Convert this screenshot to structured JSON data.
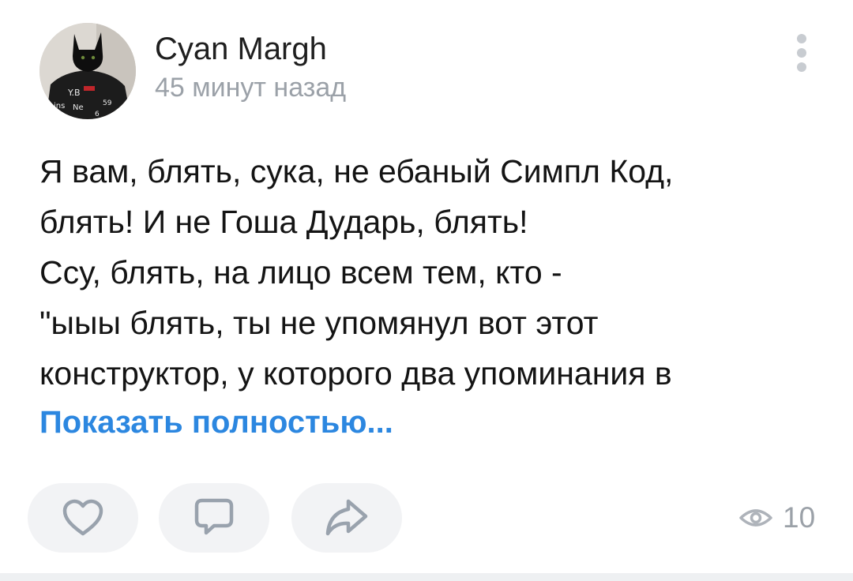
{
  "author": {
    "name": "Cyan Margh",
    "avatar_icon": "black-cat-avatar"
  },
  "post": {
    "time": "45 минут назад",
    "text_lines": [
      "Я вам, блять, сука, не ебаный Симпл Код,",
      "блять! И не Гоша Дударь, блять!",
      "Ссу, блять, на лицо всем тем, кто -",
      "\"ыыы блять, ты не упомянул вот этот",
      "конструктор, у которого два упоминания в"
    ],
    "show_more": "Показать полностью..."
  },
  "actions": {
    "like_icon": "heart-icon",
    "comment_icon": "comment-icon",
    "share_icon": "share-icon"
  },
  "stats": {
    "views_icon": "eye-icon",
    "views": "10"
  },
  "colors": {
    "link": "#2c87e0",
    "secondary_text": "#9ba1a8",
    "button_bg": "#f2f3f5",
    "icon_stroke": "#99a2ad"
  }
}
